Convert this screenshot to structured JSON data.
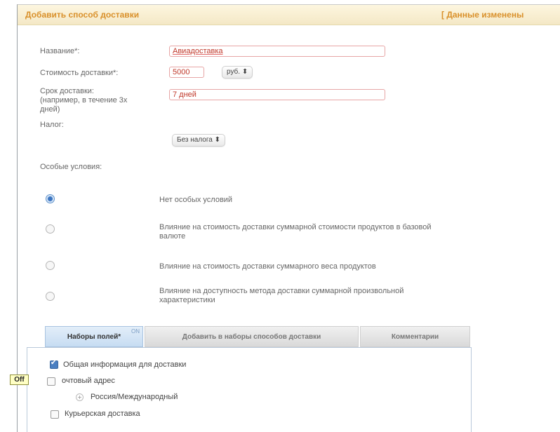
{
  "header": {
    "title": "Добавить способ доставки",
    "changed_notice": "[ Данные изменены"
  },
  "form": {
    "name": {
      "label": "Название*:",
      "value": "Авиадоставка"
    },
    "cost": {
      "label": "Стоимость доставки*:",
      "value": "5000",
      "currency": "руб. ⬍"
    },
    "term": {
      "label_line1": "Срок доставки:",
      "label_line2": "(например, в течение 3х",
      "label_line3": "дней)",
      "value": "7 дней"
    },
    "tax": {
      "label": "Налог:",
      "value": "Без налога ⬍"
    },
    "conditions_label": "Особые условия:"
  },
  "conditions": [
    {
      "line1": "Нет особых условий",
      "line2": "",
      "selected": true
    },
    {
      "line1": "Влияние на стоимость доставки суммарной стоимости продуктов в базовой",
      "line2": "валюте",
      "selected": false
    },
    {
      "line1": "Влияние на стоимость доставки суммарного веса продуктов",
      "line2": "",
      "selected": false
    },
    {
      "line1": "Влияние на доступность метода доставки суммарной произвольной",
      "line2": "характеристики",
      "selected": false
    }
  ],
  "tabs": [
    {
      "label": "Наборы полей*",
      "sup": "ON",
      "active": true
    },
    {
      "label": "Добавить в наборы способов доставки",
      "active": false
    },
    {
      "label": "Комментарии",
      "active": false
    }
  ],
  "fieldsets": {
    "general": {
      "label": "Общая информация для доставки",
      "checked": true
    },
    "postal": {
      "label": "Почтовый адрес",
      "visible_label": "очтовый адрес",
      "checked": false
    },
    "russia": {
      "label": "Россия/Международный"
    },
    "courier": {
      "label": "Курьерская доставка",
      "checked": false
    }
  },
  "tooltip": {
    "text": "Off"
  }
}
